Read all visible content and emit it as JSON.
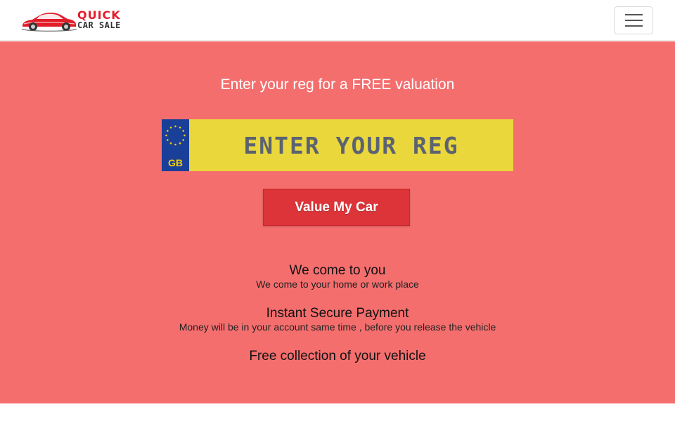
{
  "brand": {
    "line1": "QUICK",
    "line2": "CAR SALE",
    "accent_color": "#e21d2a"
  },
  "nav": {
    "menu_icon": "hamburger-menu-icon"
  },
  "hero": {
    "background_color": "#f56e6e",
    "title": "Enter your reg for a FREE valuation",
    "plate": {
      "country_code": "GB",
      "placeholder": "ENTER YOUR REG",
      "plate_color": "#e9d73c",
      "band_color": "#1a3f98",
      "band_icon": "eu-stars-icon"
    },
    "cta_label": "Value My Car",
    "cta_color": "#dc3438"
  },
  "features": [
    {
      "title": "We come to you",
      "description": "We come to your home or work place"
    },
    {
      "title": "Instant Secure Payment",
      "description": "Money will be in your account same time , before you release the vehicle"
    },
    {
      "title": "Free collection of your vehicle",
      "description": ""
    }
  ]
}
